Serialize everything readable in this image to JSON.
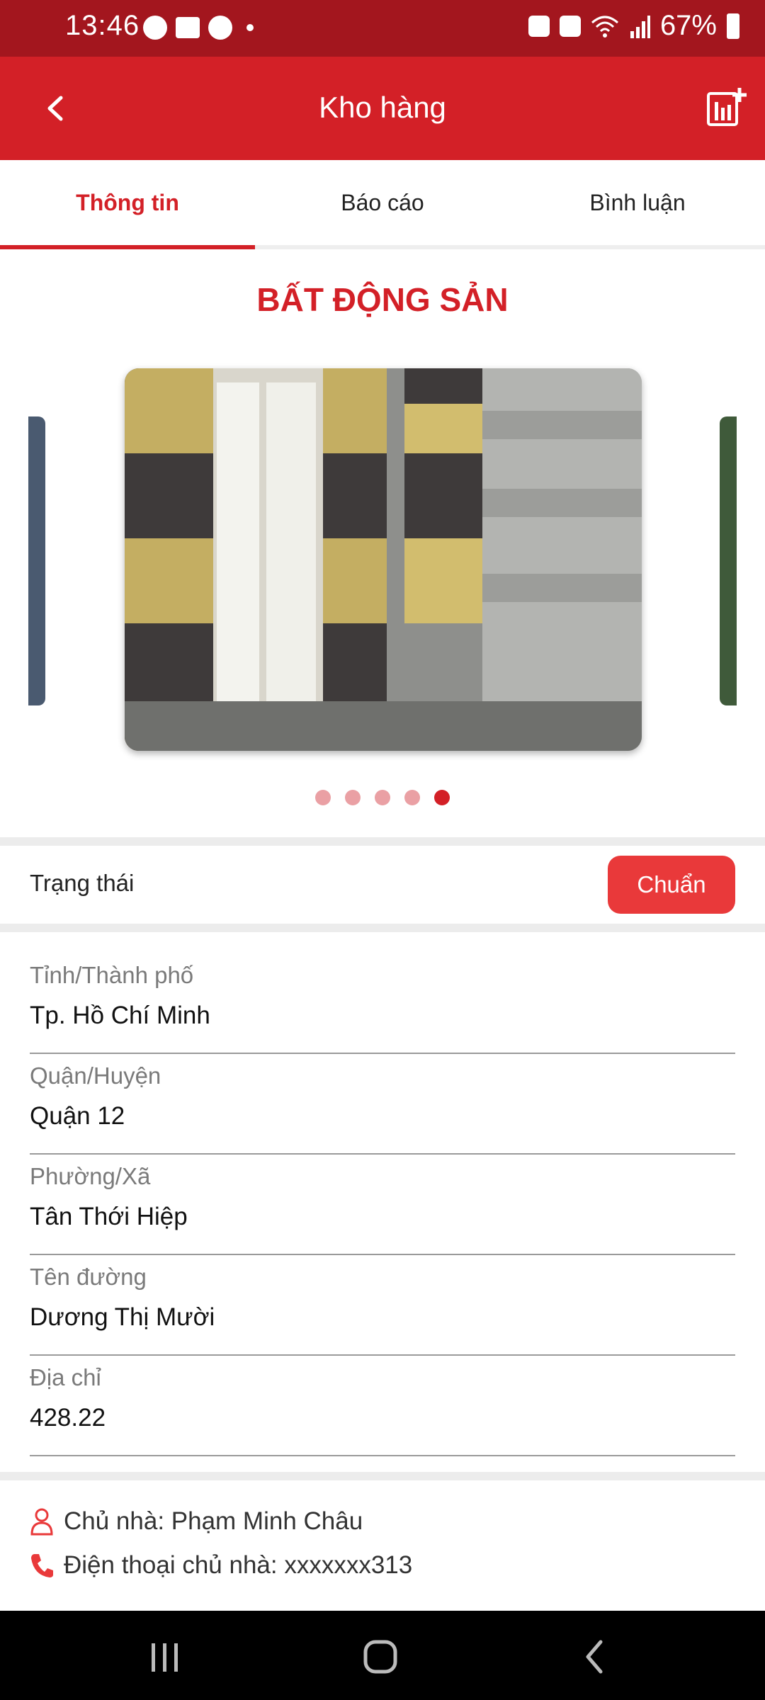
{
  "status_bar": {
    "time": "13:46",
    "battery": "67%"
  },
  "app_bar": {
    "title": "Kho hàng",
    "back_icon": "chevron-left-icon",
    "action_icon": "add-report-icon"
  },
  "tabs": [
    {
      "label": "Thông tin",
      "active": true
    },
    {
      "label": "Báo cáo",
      "active": false
    },
    {
      "label": "Bình luận",
      "active": false
    }
  ],
  "section_title": "BẤT ĐỘNG SẢN",
  "carousel": {
    "total": 5,
    "active_index": 4
  },
  "status": {
    "label": "Trạng thái",
    "value": "Chuẩn"
  },
  "fields": [
    {
      "label": "Tỉnh/Thành phố",
      "value": "Tp. Hồ Chí Minh"
    },
    {
      "label": "Quận/Huyện",
      "value": "Quận 12"
    },
    {
      "label": "Phường/Xã",
      "value": "Tân Thới Hiệp"
    },
    {
      "label": "Tên đường",
      "value": "Dương Thị Mười"
    },
    {
      "label": "Địa chỉ",
      "value": "428.22"
    }
  ],
  "owner": {
    "name_text": "Chủ nhà: Phạm Minh Châu",
    "phone_text": "Điện thoại chủ nhà: xxxxxxx313"
  },
  "colors": {
    "accent": "#d32027",
    "status_bar": "#a3161e",
    "badge": "#e9393a"
  }
}
